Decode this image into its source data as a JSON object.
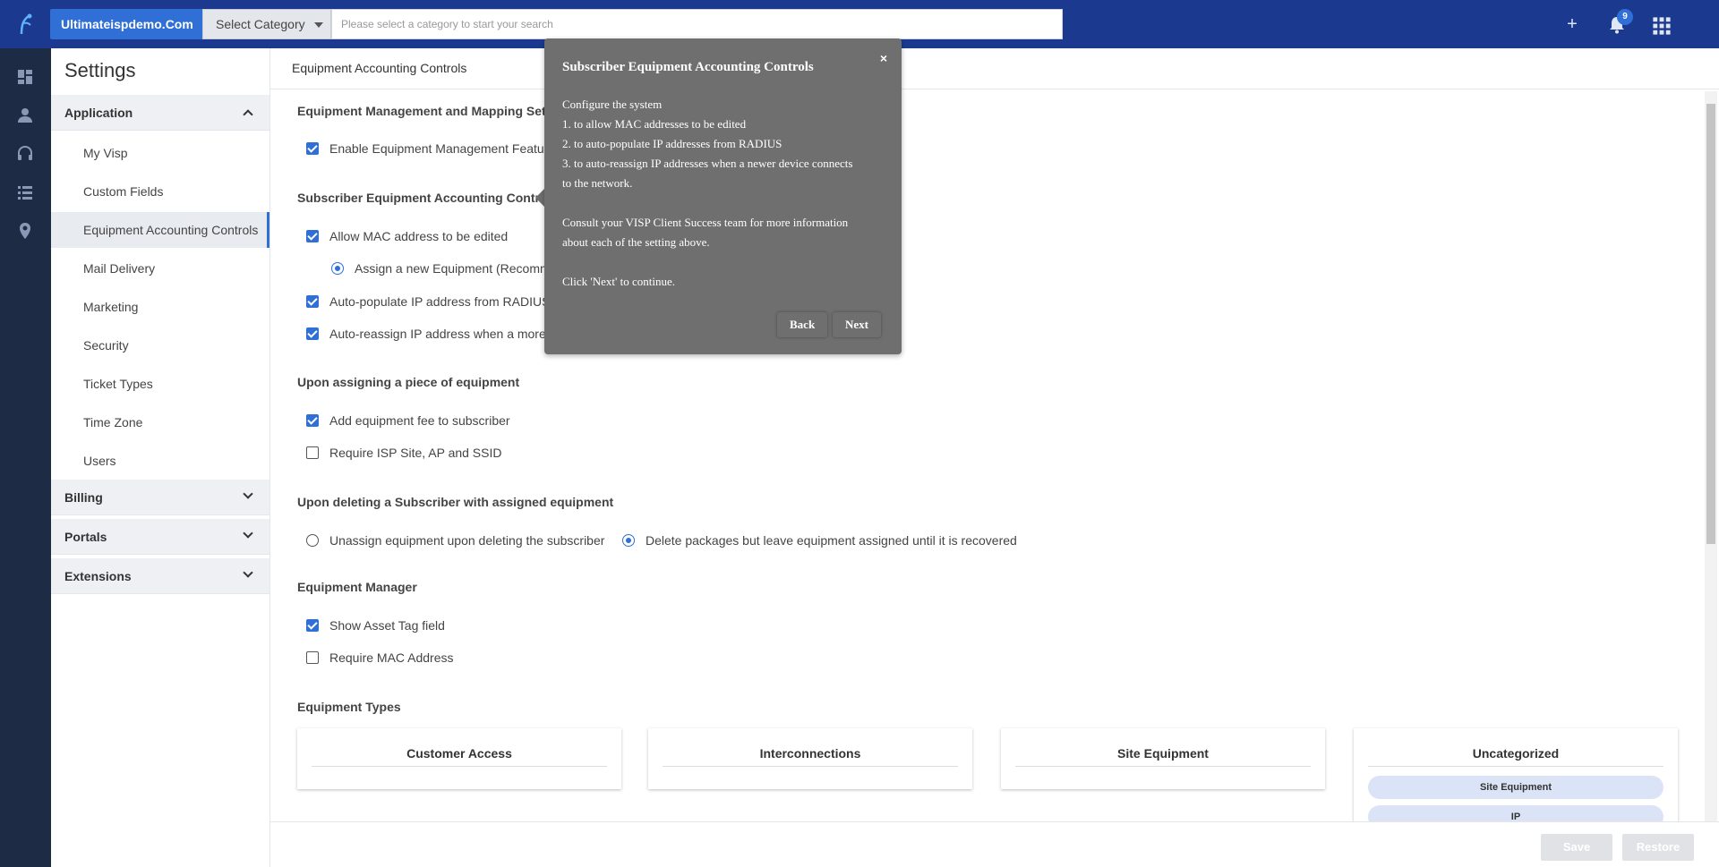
{
  "topbar": {
    "brand": "Ultimateispdemo.Com",
    "category_select": "Select Category",
    "search_placeholder": "Please select a category to start your search",
    "notification_count": "9"
  },
  "rail": {
    "help_label": "?"
  },
  "sidebar": {
    "title": "Settings",
    "sections": {
      "application": "Application",
      "billing": "Billing",
      "portals": "Portals",
      "extensions": "Extensions"
    },
    "items": [
      "My Visp",
      "Custom Fields",
      "Equipment Accounting Controls",
      "Mail Delivery",
      "Marketing",
      "Security",
      "Ticket Types",
      "Time Zone",
      "Users"
    ]
  },
  "main": {
    "header": "Equipment Accounting Controls",
    "sections": {
      "mgmt": "Equipment Management and Mapping Settings",
      "subscriber": "Subscriber Equipment Accounting Controls",
      "assigning": "Upon assigning a piece of equipment",
      "deleting": "Upon deleting a Subscriber with assigned equipment",
      "manager": "Equipment Manager",
      "types": "Equipment Types"
    },
    "options": {
      "enable_mgmt": "Enable Equipment Management Feature",
      "allow_mac": "Allow MAC address to be edited",
      "assign_new": "Assign a new Equipment (Recomme",
      "autopopulate": "Auto-populate IP address from RADIUS",
      "autoreassign": "Auto-reassign IP address when a more re",
      "add_fee": "Add equipment fee to subscriber",
      "require_site": "Require ISP Site, AP and SSID",
      "unassign": "Unassign equipment upon deleting the subscriber",
      "delete_packages": "Delete packages but leave equipment assigned until it is recovered",
      "show_asset": "Show Asset Tag field",
      "require_mac": "Require MAC Address"
    },
    "equipment_types": {
      "customer_access": "Customer Access",
      "interconnections": "Interconnections",
      "site_equipment": "Site Equipment",
      "uncategorized": "Uncategorized",
      "pill_1": "Site Equipment",
      "pill_2": "IP"
    },
    "footer": {
      "save": "Save",
      "restore": "Restore"
    }
  },
  "tooltip": {
    "title": "Subscriber Equipment Accounting Controls",
    "close": "×",
    "lines": [
      "Configure the system",
      "1. to allow MAC addresses to be edited",
      "2. to auto-populate IP addresses from RADIUS",
      "3. to auto-reassign IP addresses when a newer device connects",
      "to the network.",
      "Consult your VISP Client Success team for more information",
      "about each of the setting above.",
      "Click 'Next' to continue."
    ],
    "back": "Back",
    "next": "Next"
  },
  "colors": {
    "topbar": "#1b3a8f",
    "rail": "#1e2b44",
    "accent": "#2f6fd6",
    "tooltip": "#6f6f6f"
  }
}
